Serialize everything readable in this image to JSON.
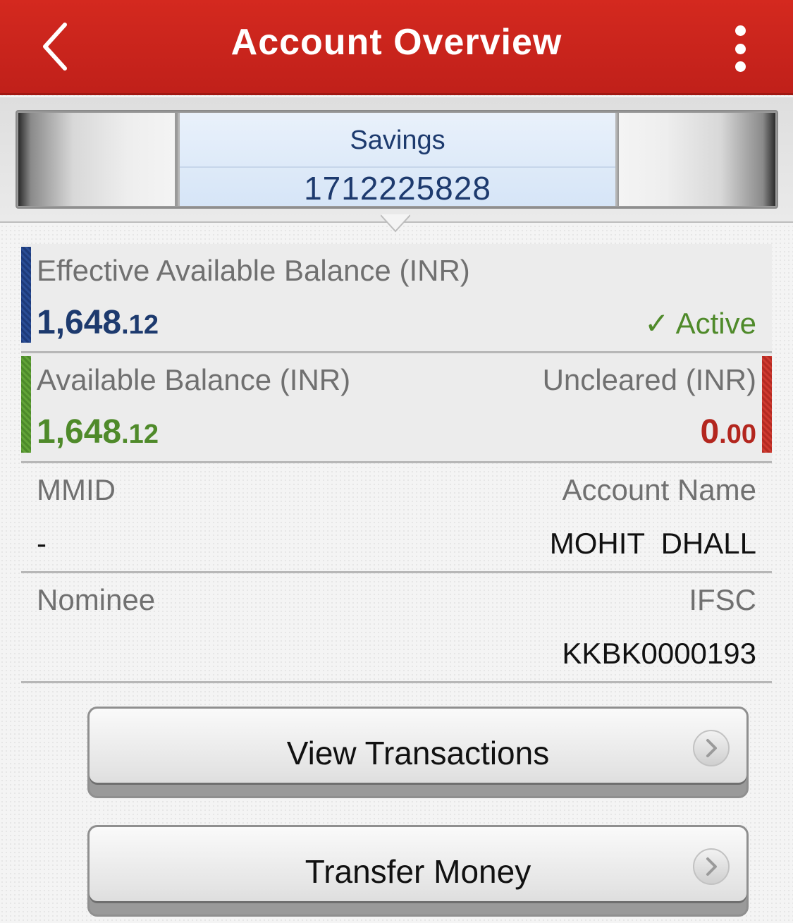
{
  "header": {
    "title": "Account Overview",
    "back_icon": "chevron-left-icon",
    "menu_icon": "kebab-menu-icon",
    "color": "#c8231b"
  },
  "account_selector": {
    "type": "Savings",
    "number": "1712225828"
  },
  "effective_balance": {
    "label": "Effective Available Balance (INR)",
    "amount_main": "1,648",
    "amount_decimal": ".12",
    "status": "✓ Active",
    "amount_color": "#1d3a6e",
    "status_color": "#4f8a2a"
  },
  "available_balance": {
    "label": "Available Balance (INR)",
    "amount_main": "1,648",
    "amount_decimal": ".12",
    "color": "#4f8a2a"
  },
  "uncleared": {
    "label": "Uncleared (INR)",
    "amount_main": "0",
    "amount_decimal": ".00",
    "color": "#b3261e"
  },
  "details": {
    "mmid_label": "MMID",
    "mmid_value": "-",
    "account_name_label": "Account Name",
    "account_name_value": "MOHIT  DHALL",
    "nominee_label": "Nominee",
    "nominee_value": "",
    "ifsc_label": "IFSC",
    "ifsc_value": "KKBK0000193"
  },
  "actions": {
    "view_transactions": "View Transactions",
    "transfer_money": "Transfer Money",
    "arrow_icon": "chevron-right-icon"
  }
}
